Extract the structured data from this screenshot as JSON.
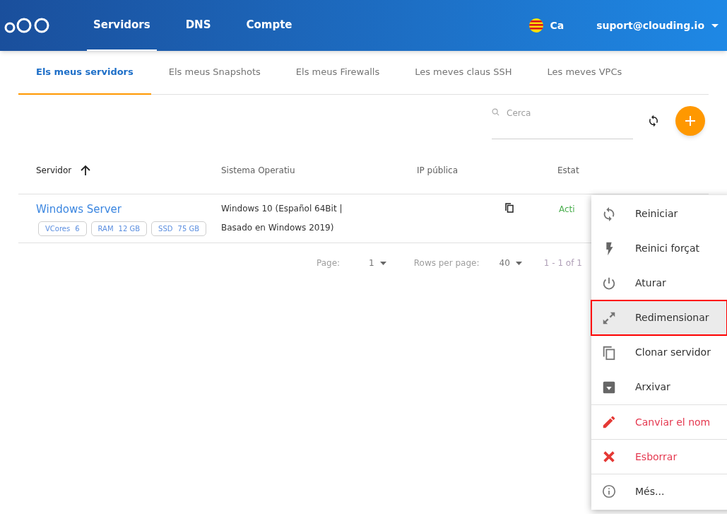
{
  "header": {
    "nav": [
      {
        "label": "Servidors",
        "selected": true
      },
      {
        "label": "DNS",
        "selected": false
      },
      {
        "label": "Compte",
        "selected": false
      }
    ],
    "language": "Ca",
    "account": "suport@clouding.io"
  },
  "tabs": [
    {
      "label": "Els meus servidors",
      "selected": true
    },
    {
      "label": "Els meus Snapshots",
      "selected": false
    },
    {
      "label": "Els meus Firewalls",
      "selected": false
    },
    {
      "label": "Les meves claus SSH",
      "selected": false
    },
    {
      "label": "Les meves VPCs",
      "selected": false
    }
  ],
  "search": {
    "placeholder": "Cerca"
  },
  "table": {
    "columns": [
      "Servidor",
      "Sistema Operatiu",
      "IP pública",
      "Estat"
    ],
    "rows": [
      {
        "name": "Windows Server",
        "specs": [
          {
            "label": "VCores",
            "value": "6"
          },
          {
            "label": "RAM",
            "value": "12 GB"
          },
          {
            "label": "SSD",
            "value": "75 GB"
          }
        ],
        "os": [
          "Windows 10 (Español 64Bit |",
          "Basado en Windows 2019)"
        ],
        "status": "Acti"
      }
    ]
  },
  "pagination": {
    "page_label": "Page:",
    "page": "1",
    "rows_label": "Rows per page:",
    "rows": "40",
    "range": "1 - 1 of 1"
  },
  "menu": [
    {
      "kind": "restart",
      "label": "Reiniciar",
      "danger": false,
      "selected": false,
      "divider_above": false
    },
    {
      "kind": "force",
      "label": "Reinici forçat",
      "danger": false,
      "selected": false,
      "divider_above": false
    },
    {
      "kind": "power",
      "label": "Aturar",
      "danger": false,
      "selected": false,
      "divider_above": false
    },
    {
      "kind": "resize",
      "label": "Redimensionar",
      "danger": false,
      "selected": true,
      "divider_above": false
    },
    {
      "kind": "clone",
      "label": "Clonar servidor",
      "danger": false,
      "selected": false,
      "divider_above": false
    },
    {
      "kind": "archive",
      "label": "Arxivar",
      "danger": false,
      "selected": false,
      "divider_above": false
    },
    {
      "kind": "rename",
      "label": "Canviar el nom",
      "danger": true,
      "selected": false,
      "divider_above": true
    },
    {
      "kind": "delete",
      "label": "Esborrar",
      "danger": true,
      "selected": false,
      "divider_above": true
    },
    {
      "kind": "info",
      "label": "Més...",
      "danger": false,
      "selected": false,
      "divider_above": true
    }
  ]
}
